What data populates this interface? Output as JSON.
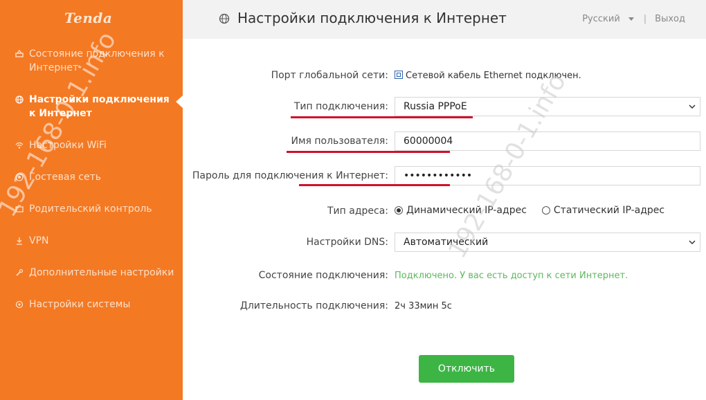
{
  "brand": "Tenda",
  "sidebar": {
    "items": [
      {
        "label": "Состояние подключения к Интернет",
        "icon": "status-icon",
        "active": false
      },
      {
        "label": "Настройки подключения к Интернет",
        "icon": "globe-icon",
        "active": true
      },
      {
        "label": "Настройки WiFi",
        "icon": "wifi-icon",
        "active": false
      },
      {
        "label": "Гостевая сеть",
        "icon": "guest-icon",
        "active": false
      },
      {
        "label": "Родительский контроль",
        "icon": "parental-icon",
        "active": false
      },
      {
        "label": "VPN",
        "icon": "vpn-icon",
        "active": false
      },
      {
        "label": "Дополнительные настройки",
        "icon": "wrench-icon",
        "active": false
      },
      {
        "label": "Настройки системы",
        "icon": "system-icon",
        "active": false
      }
    ]
  },
  "header": {
    "title": "Настройки подключения к Интернет",
    "language": "Русский",
    "logout": "Выход"
  },
  "form": {
    "wan_port_label": "Порт глобальной сети:",
    "wan_port_value": "Сетевой кабель Ethernet подключен.",
    "conn_type_label": "Тип подключения:",
    "conn_type_value": "Russia PPPoE",
    "username_label": "Имя пользователя:",
    "username_value": "60000004",
    "password_label": "Пароль для подключения к Интернет:",
    "password_value": "••••••••••••",
    "addr_type_label": "Тип адреса:",
    "addr_dynamic": "Динамический IP-адрес",
    "addr_static": "Статический IP-адрес",
    "dns_label": "Настройки DNS:",
    "dns_value": "Автоматический",
    "conn_status_label": "Состояние подключения:",
    "conn_status_value": "Подключено. У вас есть доступ к сети Интернет.",
    "duration_label": "Длительность подключения:",
    "duration_value": "2ч 33мин 5с",
    "disconnect_button": "Отключить"
  },
  "colors": {
    "sidebar": "#f47923",
    "button": "#3cb545",
    "status": "#5cb85c",
    "highlight": "#d0102a"
  },
  "watermark": "192-168-0-1.info"
}
